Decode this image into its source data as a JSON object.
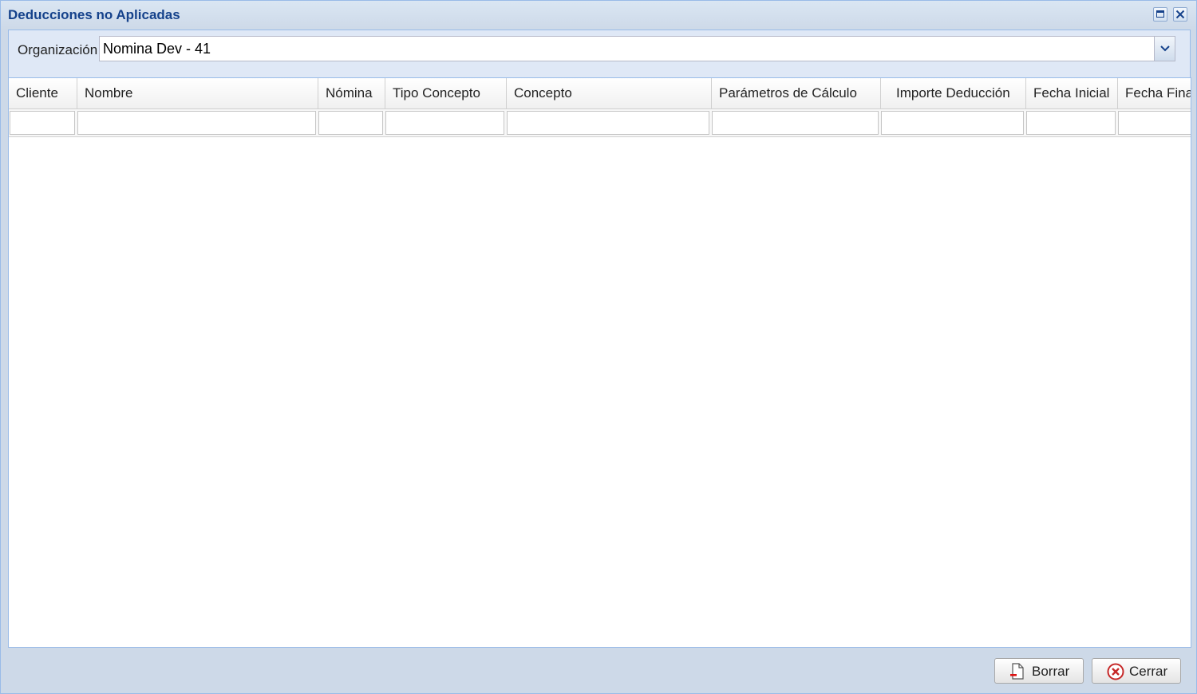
{
  "window": {
    "title": "Deducciones no Aplicadas"
  },
  "form": {
    "organization_label": "Organización",
    "organization_value": "Nomina Dev - 41"
  },
  "grid": {
    "columns": [
      {
        "label": "Cliente"
      },
      {
        "label": "Nombre"
      },
      {
        "label": "Nómina"
      },
      {
        "label": "Tipo Concepto"
      },
      {
        "label": "Concepto"
      },
      {
        "label": "Parámetros de Cálculo"
      },
      {
        "label": "Importe Deducción"
      },
      {
        "label": "Fecha Inicial"
      },
      {
        "label": "Fecha Final"
      }
    ],
    "rows": []
  },
  "footer": {
    "borrar_label": "Borrar",
    "cerrar_label": "Cerrar"
  },
  "icons": {
    "maximize": "maximize-icon",
    "close": "close-icon",
    "dropdown": "chevron-down-icon",
    "borrar": "delete-document-icon",
    "cerrar": "cancel-circle-icon"
  },
  "colors": {
    "title": "#15428b",
    "window_bg": "#cdd9e8",
    "border": "#99bbe8"
  }
}
